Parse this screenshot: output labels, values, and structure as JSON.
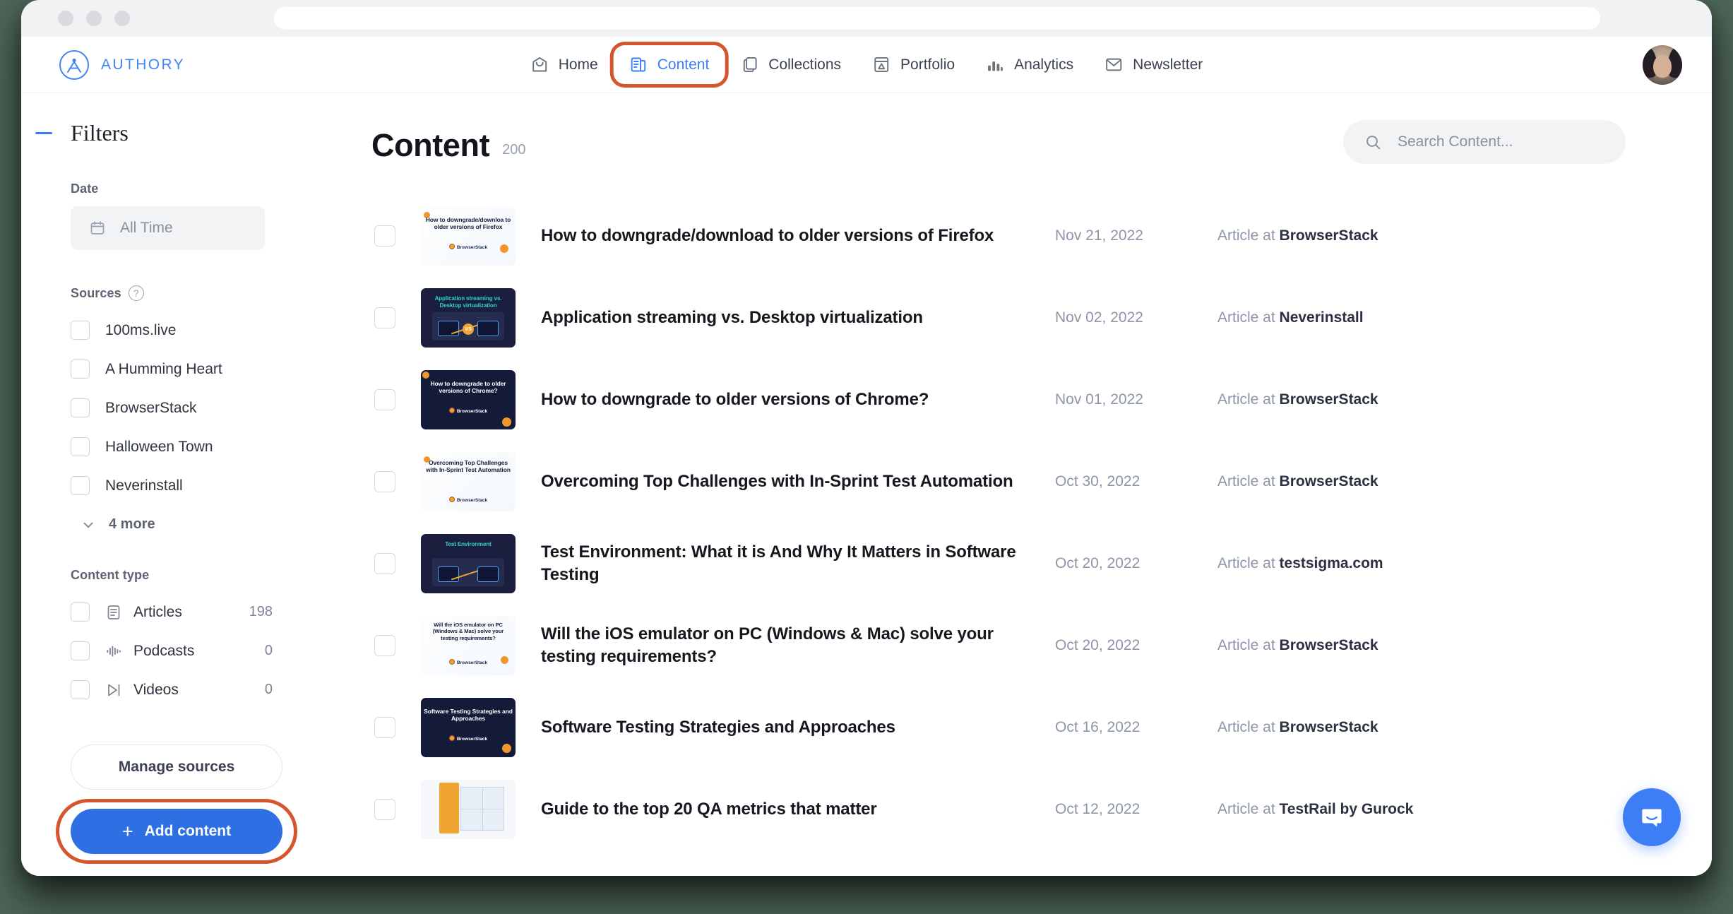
{
  "browser": {
    "url_value": "",
    "url_placeholder": "",
    "traffic_lights": [
      "close",
      "minimize",
      "zoom"
    ]
  },
  "brand": {
    "name": "AUTHORY",
    "icon": "authory-logo-icon",
    "color": "#4285f4"
  },
  "topnav": {
    "items": [
      {
        "label": "Home",
        "icon": "home-icon",
        "active": false
      },
      {
        "label": "Content",
        "icon": "content-document-icon",
        "active": true,
        "annotated": true
      },
      {
        "label": "Collections",
        "icon": "collections-stack-icon",
        "active": false
      },
      {
        "label": "Portfolio",
        "icon": "portfolio-layout-icon",
        "active": false
      },
      {
        "label": "Analytics",
        "icon": "analytics-bars-icon",
        "active": false
      },
      {
        "label": "Newsletter",
        "icon": "envelope-icon",
        "active": false
      }
    ],
    "avatar": "user-avatar"
  },
  "sidebar": {
    "title": "Filters",
    "collapse_icon": "minus-collapse-icon",
    "date": {
      "label": "Date",
      "value": "All Time",
      "icon": "calendar-icon"
    },
    "sources": {
      "label": "Sources",
      "help_icon": "question-mark-icon",
      "items": [
        {
          "label": "100ms.live",
          "checked": false
        },
        {
          "label": "A Humming Heart",
          "checked": false
        },
        {
          "label": "BrowserStack",
          "checked": false
        },
        {
          "label": "Halloween Town",
          "checked": false
        },
        {
          "label": "Neverinstall",
          "checked": false
        }
      ],
      "more_label": "4 more",
      "more_icon": "chevron-down-icon"
    },
    "content_type": {
      "label": "Content type",
      "items": [
        {
          "label": "Articles",
          "count": "198",
          "icon": "article-icon",
          "checked": false
        },
        {
          "label": "Podcasts",
          "count": "0",
          "icon": "podcast-wave-icon",
          "checked": false
        },
        {
          "label": "Videos",
          "count": "0",
          "icon": "video-play-icon",
          "checked": false
        }
      ]
    },
    "manage_sources_label": "Manage sources",
    "add_content_label": "Add content",
    "add_content_plus": "+",
    "add_content_annotated": true
  },
  "main": {
    "title": "Content",
    "count": "200",
    "search": {
      "placeholder": "Search Content...",
      "value": "",
      "icon": "search-icon"
    },
    "rows": [
      {
        "title": "How to downgrade/download to older versions of Firefox",
        "date": "Nov 21, 2022",
        "source_prefix": "Article at ",
        "source": "BrowserStack",
        "thumb_style": "light",
        "thumb_text": "How to downgrade/downloa to older versions of Firefox",
        "thumb_badge": "BrowserStack"
      },
      {
        "title": "Application streaming vs. Desktop virtualization",
        "date": "Nov 02, 2022",
        "source_prefix": "Article at ",
        "source": "Neverinstall",
        "thumb_style": "navy",
        "thumb_text": "Application streaming vs. Desktop virtualization",
        "thumb_badge": ""
      },
      {
        "title": "How to downgrade to older versions of Chrome?",
        "date": "Nov 01, 2022",
        "source_prefix": "Article at ",
        "source": "BrowserStack",
        "thumb_style": "dark",
        "thumb_text": "How to downgrade to older versions of Chrome?",
        "thumb_badge": "BrowserStack"
      },
      {
        "title": "Overcoming Top Challenges with In-Sprint Test Automation",
        "date": "Oct 30, 2022",
        "source_prefix": "Article at ",
        "source": "BrowserStack",
        "thumb_style": "light",
        "thumb_text": "Overcoming Top Challenges with In-Sprint Test Automation",
        "thumb_badge": "BrowserStack"
      },
      {
        "title": "Test Environment: What it is And Why It Matters in Software Testing",
        "date": "Oct 20, 2022",
        "source_prefix": "Article at ",
        "source": "testsigma.com",
        "thumb_style": "navy",
        "thumb_text": "Test Environment",
        "thumb_badge": ""
      },
      {
        "title": "Will the iOS emulator on PC (Windows & Mac) solve your testing requirements?",
        "date": "Oct 20, 2022",
        "source_prefix": "Article at ",
        "source": "BrowserStack",
        "thumb_style": "light",
        "thumb_text": "Will the iOS emulator on PC (Windows & Mac) solve your testing requirements?",
        "thumb_badge": "BrowserStack"
      },
      {
        "title": "Software Testing Strategies and Approaches",
        "date": "Oct 16, 2022",
        "source_prefix": "Article at ",
        "source": "BrowserStack",
        "thumb_style": "dark",
        "thumb_text": "Software Testing Strategies and Approaches",
        "thumb_badge": "BrowserStack"
      },
      {
        "title": "Guide to the top 20 QA metrics that matter",
        "date": "Oct 12, 2022",
        "source_prefix": "Article at ",
        "source": "TestRail by Gurock",
        "thumb_style": "photo",
        "thumb_text": "",
        "thumb_badge": ""
      }
    ]
  },
  "chat": {
    "icon": "intercom-chat-icon",
    "color": "#3d7df6"
  },
  "annotation_color": "#d4552e"
}
